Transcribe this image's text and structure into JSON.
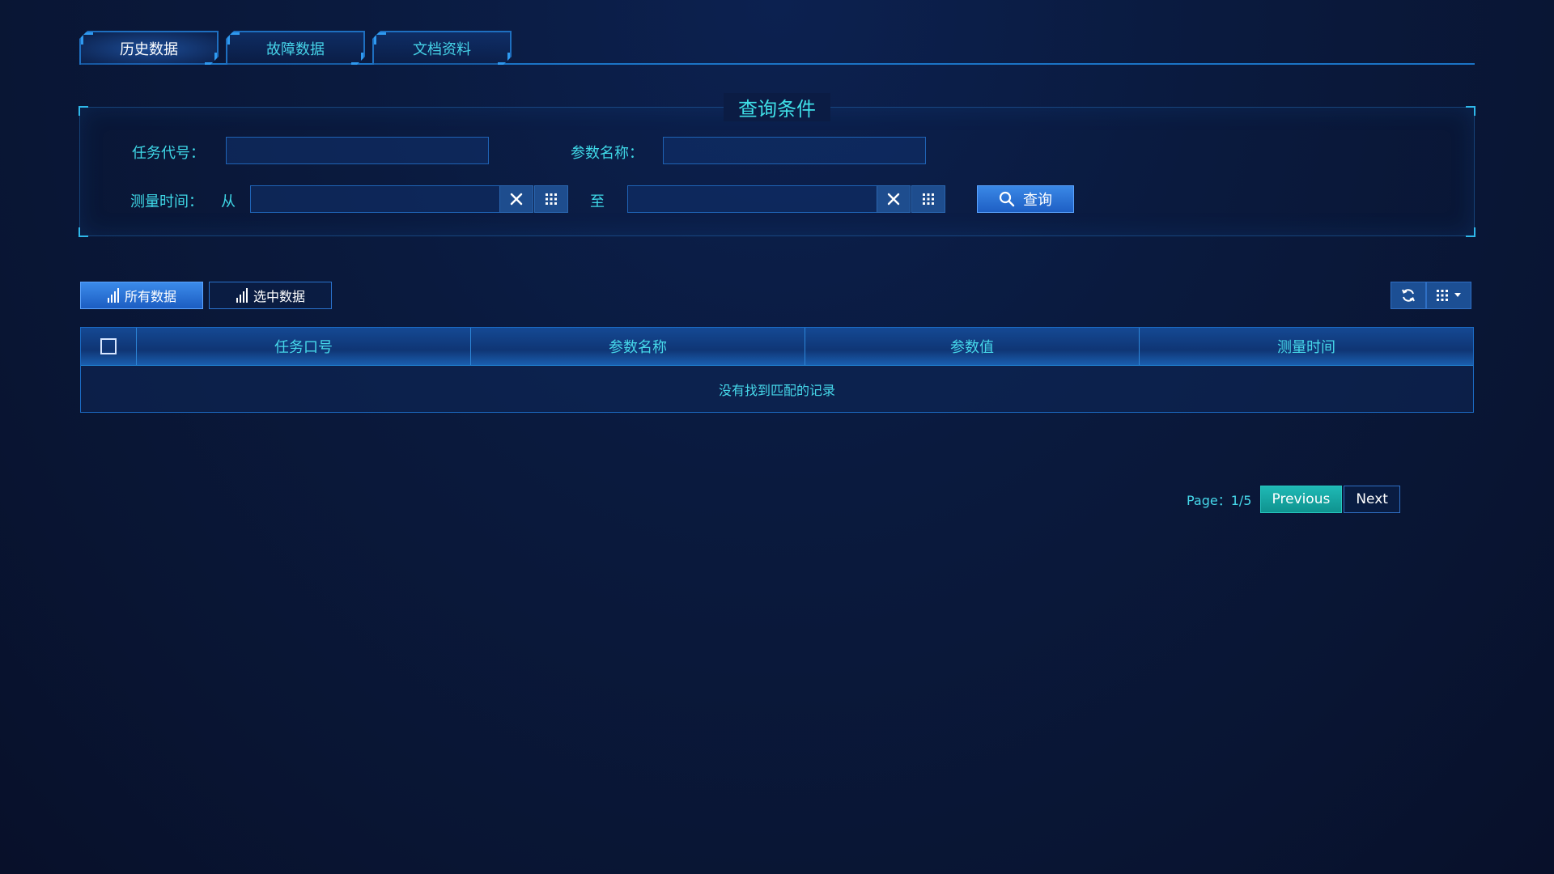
{
  "tabs": [
    {
      "label": "历史数据",
      "active": true
    },
    {
      "label": "故障数据",
      "active": false
    },
    {
      "label": "文档资料",
      "active": false
    }
  ],
  "query": {
    "title": "查询条件",
    "task_code_label": "任务代号：",
    "task_code_value": "",
    "param_name_label": "参数名称：",
    "param_name_value": "",
    "measure_time_label": "测量时间：",
    "from_label": "从",
    "from_value": "",
    "to_label": "至",
    "to_value": "",
    "query_button": "查询"
  },
  "data_buttons": {
    "all": "所有数据",
    "selected": "选中数据"
  },
  "icons": {
    "clear": "close-icon",
    "grid": "grid-icon",
    "search": "search-icon",
    "refresh": "refresh-icon",
    "bar_chart": "bar-chart-icon",
    "dropdown": "chevron-down-icon"
  },
  "table": {
    "headers": [
      "任务口号",
      "参数名称",
      "参数值",
      "测量时间"
    ],
    "empty_text": "没有找到匹配的记录"
  },
  "pagination": {
    "info": "Page：1/5",
    "previous": "Previous",
    "next": "Next"
  },
  "colors": {
    "accent_cyan": "#3fd7e6",
    "primary_blue": "#2a78d8",
    "teal_button": "#16a9a5",
    "background": "#0a1a3e"
  }
}
